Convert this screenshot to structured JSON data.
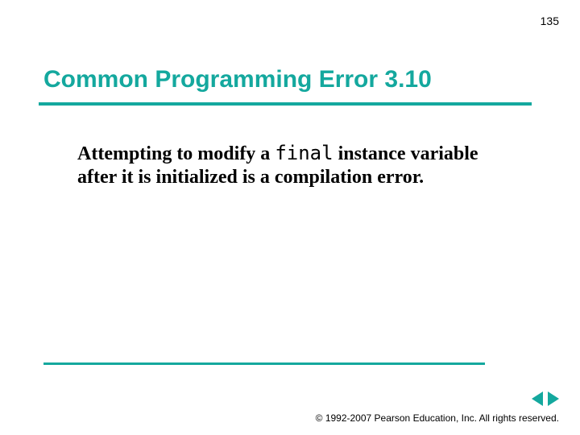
{
  "page_number": "135",
  "title": "Common Programming Error 3.10",
  "body": {
    "prefix": "Attempting to modify a ",
    "code": "final",
    "suffix": " instance variable after it is initialized is a compilation error."
  },
  "copyright": "© 1992-2007 Pearson Education, Inc.  All rights reserved."
}
